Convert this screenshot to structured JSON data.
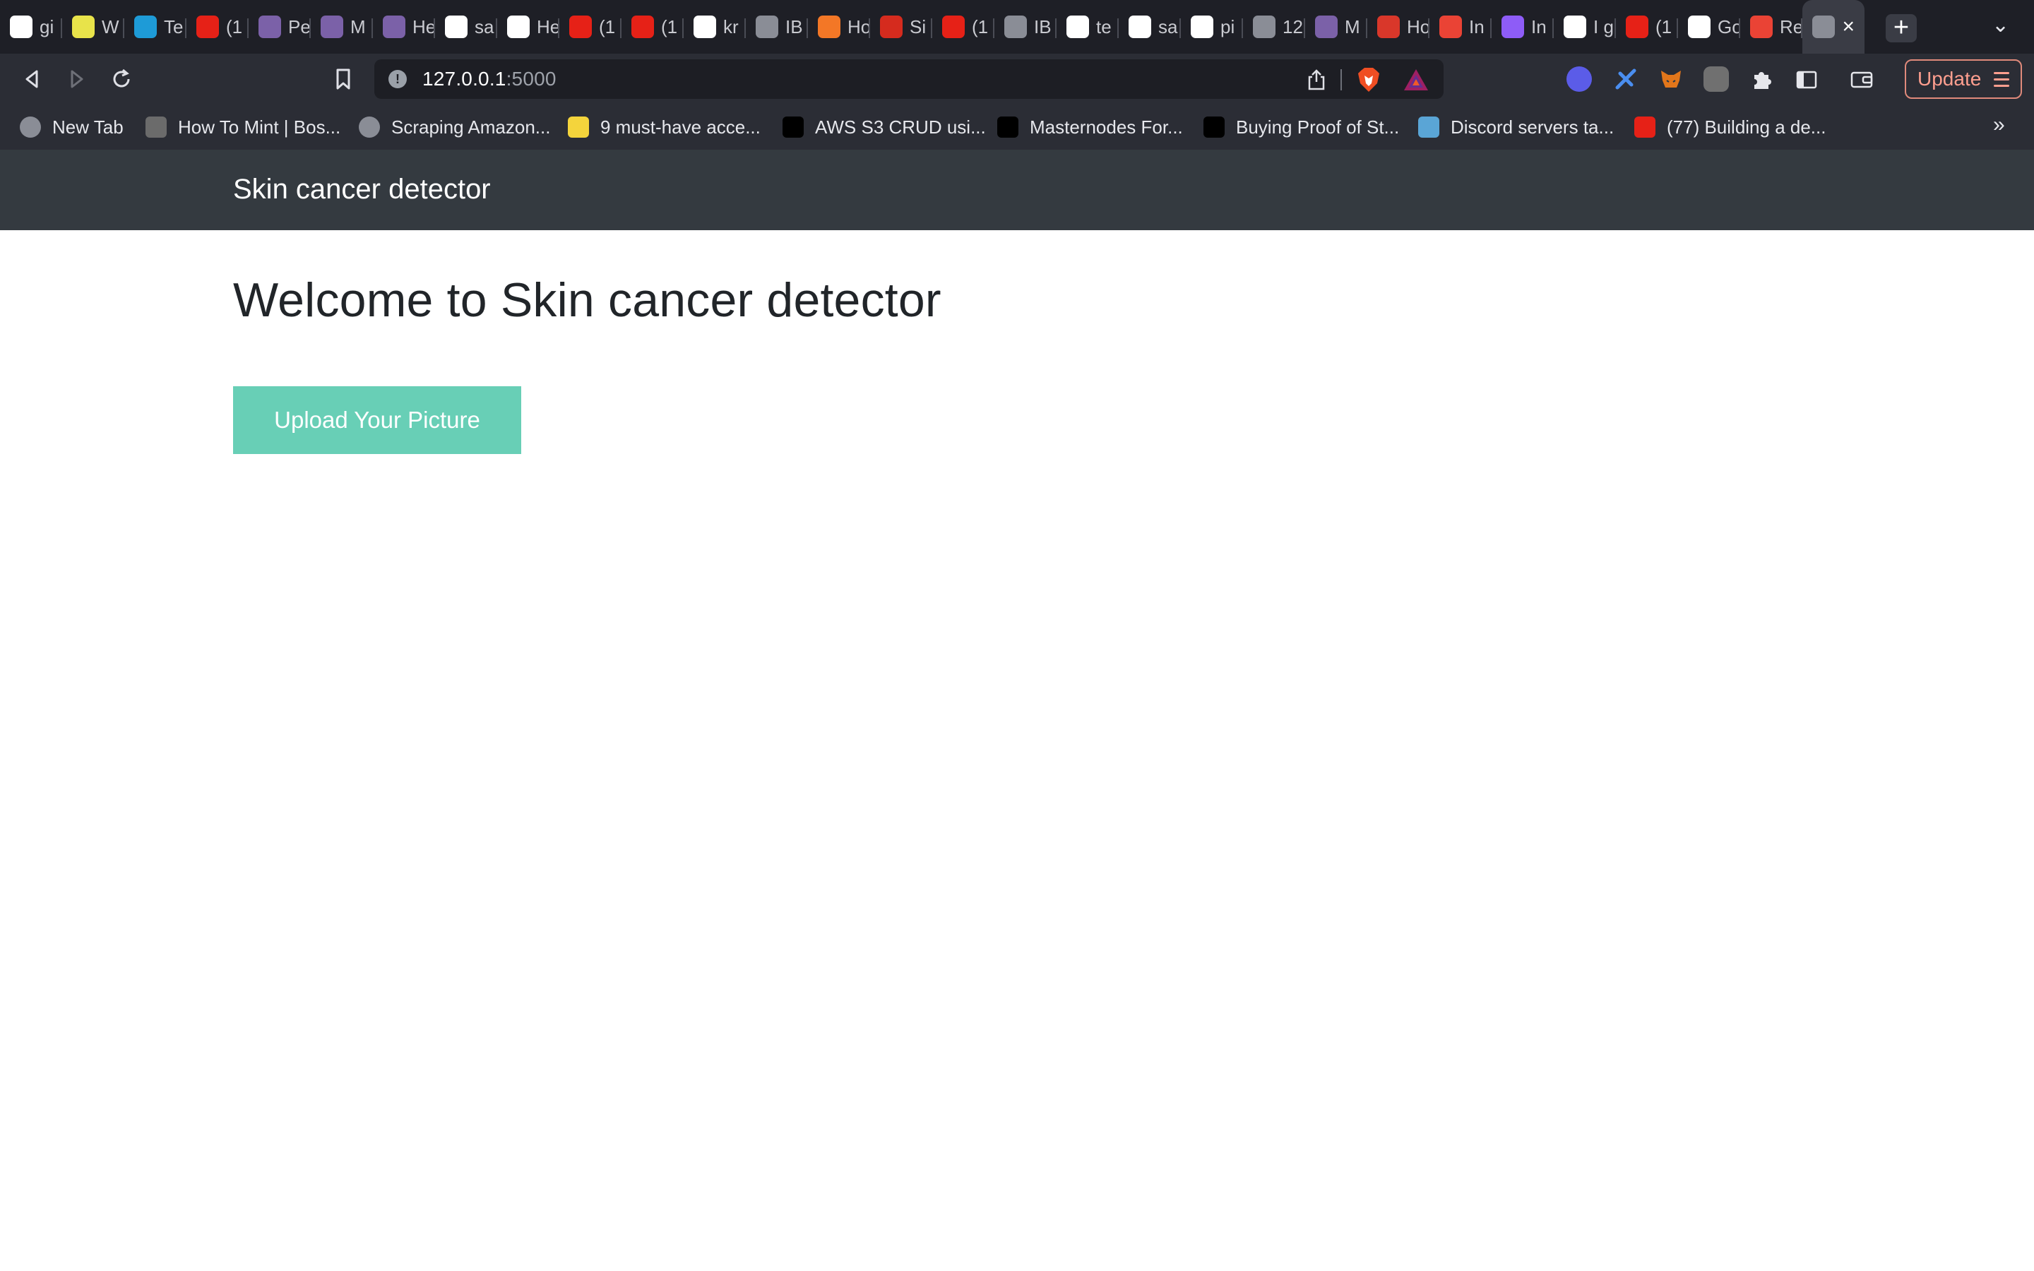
{
  "browser": {
    "tabs": [
      {
        "label": "gi",
        "icon": "google-icon",
        "color": "#ffffff"
      },
      {
        "label": "W",
        "icon": "tennis-ball-icon",
        "color": "#e8e34a"
      },
      {
        "label": "Te",
        "icon": "k-logo-icon",
        "color": "#1e9bd7"
      },
      {
        "label": "(1",
        "icon": "youtube-icon",
        "color": "#e62117"
      },
      {
        "label": "Pe",
        "icon": "heroku-icon",
        "color": "#7b61a8"
      },
      {
        "label": "M",
        "icon": "heroku-icon",
        "color": "#7b61a8"
      },
      {
        "label": "He",
        "icon": "heroku-icon",
        "color": "#7b61a8"
      },
      {
        "label": "sa",
        "icon": "github-icon",
        "color": "#ffffff"
      },
      {
        "label": "He",
        "icon": "github-icon",
        "color": "#ffffff"
      },
      {
        "label": "(1",
        "icon": "youtube-icon",
        "color": "#e62117"
      },
      {
        "label": "(1",
        "icon": "youtube-icon",
        "color": "#e62117"
      },
      {
        "label": "kr",
        "icon": "github-icon",
        "color": "#ffffff"
      },
      {
        "label": "IB",
        "icon": "globe-icon",
        "color": "#8a8d96"
      },
      {
        "label": "Ho",
        "icon": "jupyter-icon",
        "color": "#f37726"
      },
      {
        "label": "Si",
        "icon": "maple-leaf-icon",
        "color": "#d52b1e"
      },
      {
        "label": "(1",
        "icon": "youtube-icon",
        "color": "#e62117"
      },
      {
        "label": "IB",
        "icon": "globe-icon",
        "color": "#8a8d96"
      },
      {
        "label": "te",
        "icon": "cube-icon",
        "color": "#ffffff"
      },
      {
        "label": "sa",
        "icon": "github-icon",
        "color": "#ffffff"
      },
      {
        "label": "pi",
        "icon": "github-icon",
        "color": "#ffffff"
      },
      {
        "label": "12",
        "icon": "globe-icon",
        "color": "#8a8d96"
      },
      {
        "label": "M",
        "icon": "heroku-icon",
        "color": "#7b61a8"
      },
      {
        "label": "Ho",
        "icon": "checkmark-icon",
        "color": "#d9372a"
      },
      {
        "label": "In",
        "icon": "gmail-icon",
        "color": "#ea4335"
      },
      {
        "label": "In",
        "icon": "puzzle-logo-icon",
        "color": "#8e5cf7"
      },
      {
        "label": "I g",
        "icon": "google-icon",
        "color": "#ffffff"
      },
      {
        "label": "(1",
        "icon": "youtube-icon",
        "color": "#e62117"
      },
      {
        "label": "Go",
        "icon": "google-icon",
        "color": "#ffffff"
      },
      {
        "label": "Re",
        "icon": "gmail-icon",
        "color": "#ea4335"
      },
      {
        "label": "",
        "icon": "globe-icon",
        "color": "#8a8d96",
        "active": true
      }
    ],
    "address": {
      "host": "127.0.0.1",
      "port": ":5000"
    },
    "update_label": "Update",
    "bookmarks": [
      {
        "label": "New Tab",
        "icon": "globe-icon",
        "color": "#8a8d96"
      },
      {
        "label": "How To Mint | Bos...",
        "icon": "bosslogics-icon",
        "color": "#6b6b6b"
      },
      {
        "label": "Scraping Amazon...",
        "icon": "globe-icon",
        "color": "#8a8d96"
      },
      {
        "label": "9 must-have acce...",
        "icon": "im-logo-icon",
        "color": "#f4d43c"
      },
      {
        "label": "AWS S3 CRUD usi...",
        "icon": "medium-icon",
        "color": "#000000"
      },
      {
        "label": "Masternodes For...",
        "icon": "medium-icon",
        "color": "#000000"
      },
      {
        "label": "Buying Proof of St...",
        "icon": "medium-icon",
        "color": "#000000"
      },
      {
        "label": "Discord servers ta...",
        "icon": "discord-servers-icon",
        "color": "#5aa5d6"
      },
      {
        "label": "(77) Building a de...",
        "icon": "youtube-icon",
        "color": "#e62117"
      }
    ]
  },
  "site": {
    "brand": "Skin cancer detector",
    "heading": "Welcome to Skin cancer detector",
    "upload_label": "Upload Your Picture",
    "accent": "#68cfb6",
    "navbar_color": "#343a40"
  }
}
